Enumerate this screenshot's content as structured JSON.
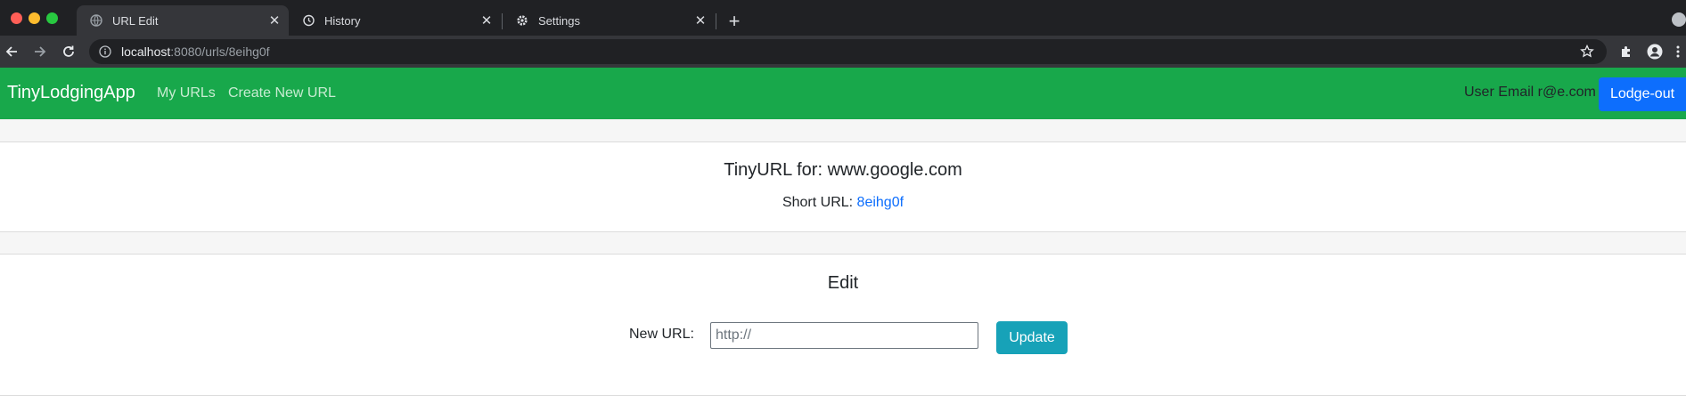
{
  "browser": {
    "tabs": [
      {
        "label": "URL Edit",
        "icon": "globe-icon",
        "active": true
      },
      {
        "label": "History",
        "icon": "history-icon",
        "active": false
      },
      {
        "label": "Settings",
        "icon": "gear-icon",
        "active": false
      }
    ],
    "address": {
      "host": "localhost",
      "rest": ":8080/urls/8eihg0f"
    }
  },
  "navbar": {
    "brand": "TinyLodgingApp",
    "links": [
      "My URLs",
      "Create New URL"
    ],
    "user_email": "User Email r@e.com",
    "logout_label": "Lodge-out",
    "color": "#18a84b"
  },
  "summary": {
    "title": "TinyURL for: www.google.com",
    "short_label": "Short URL:",
    "short_code": "8eihg0f"
  },
  "edit": {
    "title": "Edit",
    "field_label": "New URL:",
    "placeholder": "http://",
    "button_label": "Update"
  }
}
